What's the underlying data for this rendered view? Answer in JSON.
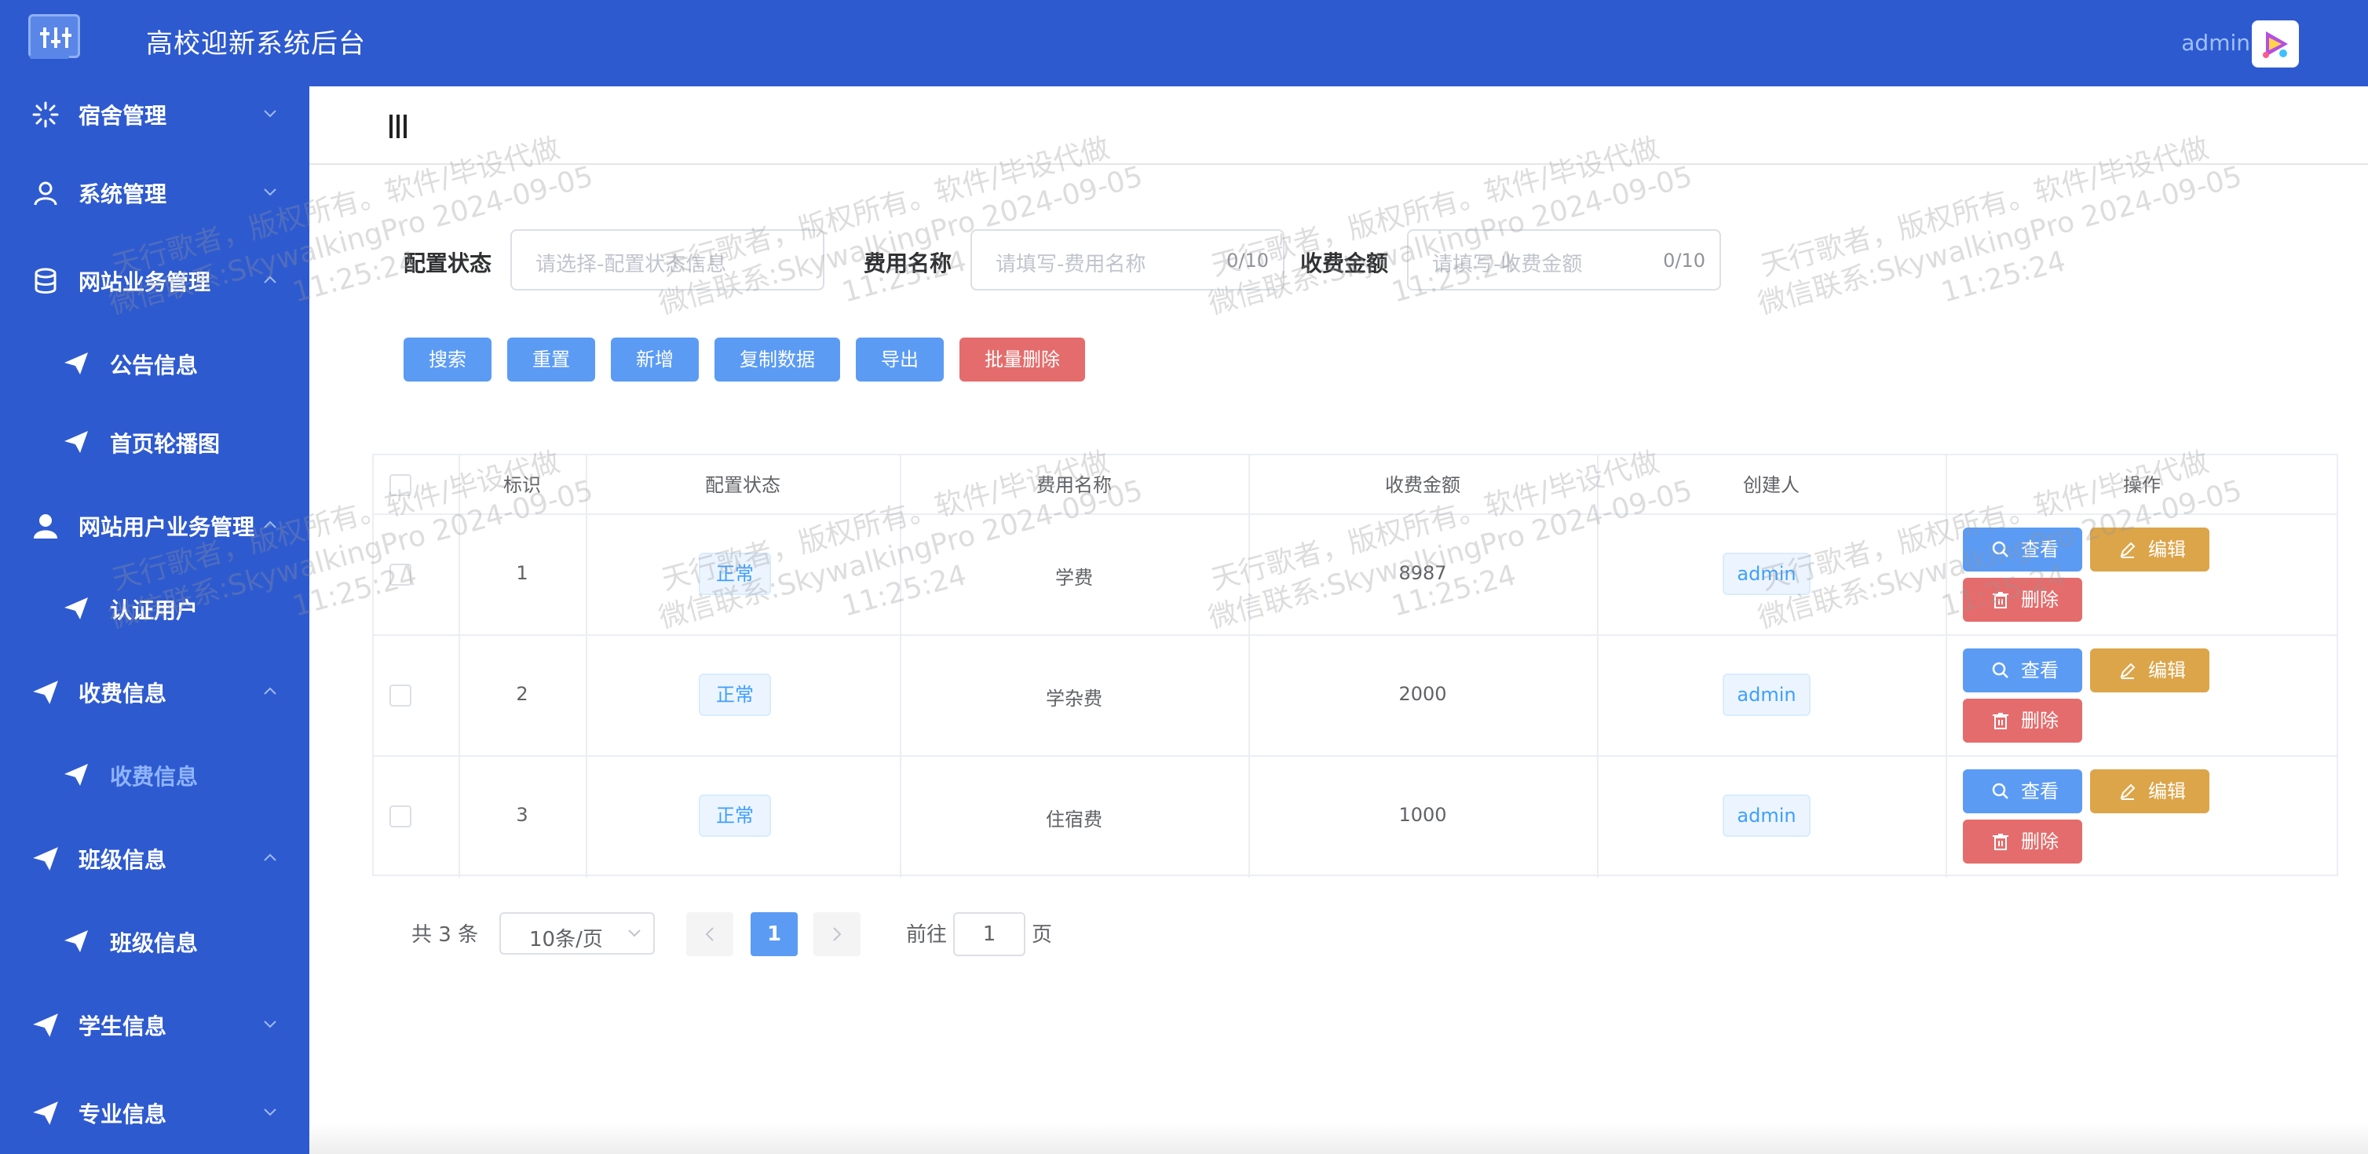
{
  "header": {
    "title": "高校迎新系统后台",
    "user": "admin"
  },
  "sidebar": {
    "items": [
      {
        "label": "宿舍管理",
        "icon": "loading-icon"
      },
      {
        "label": "系统管理",
        "icon": "user-outline-icon"
      },
      {
        "label": "网站业务管理",
        "icon": "database-icon"
      },
      {
        "label": "公告信息",
        "icon": "paper-plane-icon",
        "sub": true
      },
      {
        "label": "首页轮播图",
        "icon": "paper-plane-icon",
        "sub": true
      },
      {
        "label": "网站用户业务管理",
        "icon": "user-solid-icon"
      },
      {
        "label": "认证用户",
        "icon": "paper-plane-icon",
        "sub": true
      },
      {
        "label": "收费信息",
        "icon": "paper-plane-icon"
      },
      {
        "label": "收费信息",
        "icon": "paper-plane-icon",
        "sub": true,
        "active": true
      },
      {
        "label": "班级信息",
        "icon": "paper-plane-icon"
      },
      {
        "label": "班级信息",
        "icon": "paper-plane-icon",
        "sub": true
      },
      {
        "label": "学生信息",
        "icon": "paper-plane-icon"
      },
      {
        "label": "专业信息",
        "icon": "paper-plane-icon"
      }
    ]
  },
  "filters": {
    "status_label": "配置状态",
    "status_placeholder": "请选择-配置状态信息",
    "name_label": "费用名称",
    "name_placeholder": "请填写-费用名称",
    "name_count": "0/10",
    "amount_label": "收费金额",
    "amount_placeholder": "请填写-收费金额",
    "amount_count": "0/10"
  },
  "toolbar": {
    "search": "搜索",
    "reset": "重置",
    "add": "新增",
    "copy": "复制数据",
    "export": "导出",
    "batch_delete": "批量删除"
  },
  "table": {
    "headers": [
      "标识",
      "配置状态",
      "费用名称",
      "收费金额",
      "创建人",
      "操作"
    ],
    "rows": [
      {
        "id": "1",
        "status": "正常",
        "name": "学费",
        "amount": "8987",
        "creator": "admin"
      },
      {
        "id": "2",
        "status": "正常",
        "name": "学杂费",
        "amount": "2000",
        "creator": "admin"
      },
      {
        "id": "3",
        "status": "正常",
        "name": "住宿费",
        "amount": "1000",
        "creator": "admin"
      }
    ],
    "actions": {
      "view": "查看",
      "edit": "编辑",
      "delete": "删除"
    }
  },
  "pagination": {
    "total": "共 3 条",
    "page_size": "10条/页",
    "current": "1",
    "goto_label": "前往",
    "goto_value": "1",
    "page_suffix": "页"
  },
  "watermark": {
    "line1": "天行歌者，版权所有。软件/毕设代做",
    "line2": "微信联系:SkywalkingPro 2024-09-05",
    "line3": "11:25:24"
  }
}
